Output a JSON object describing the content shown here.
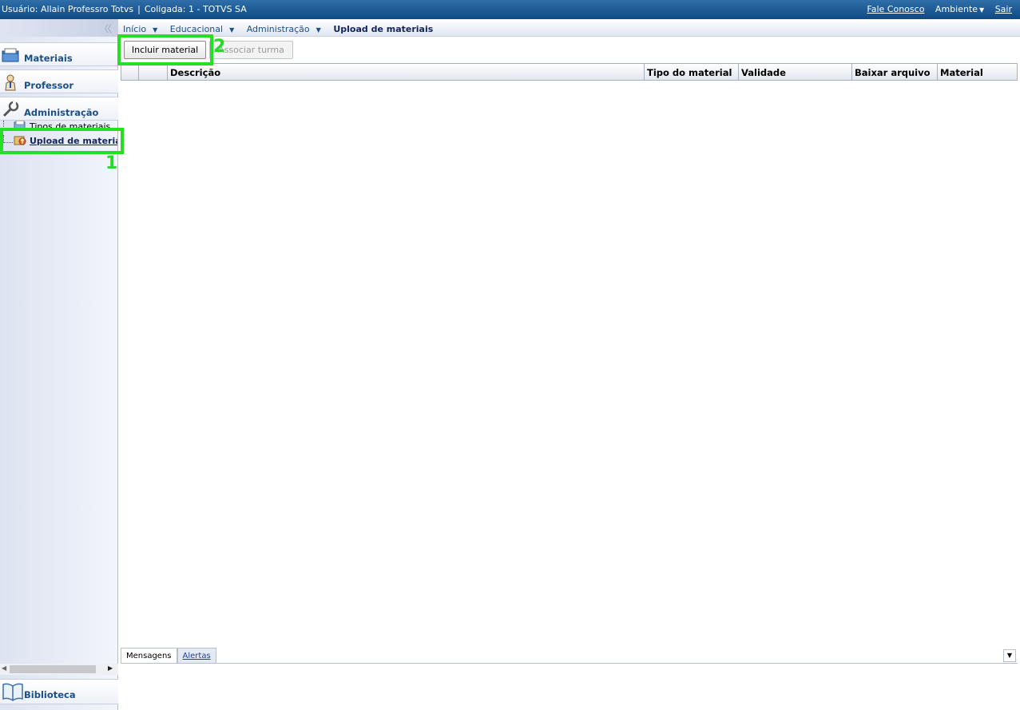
{
  "topbar": {
    "user": "Usuário: Allain Professro Totvs",
    "coligada": "Coligada: 1 - TOTVS SA",
    "fale_conosco": "Fale Conosco",
    "ambiente": "Ambiente",
    "sair": "Sair"
  },
  "sidebar": {
    "sections": [
      {
        "label": "Materiais",
        "icon": "folder-icon"
      },
      {
        "label": "Professor",
        "icon": "person-icon"
      },
      {
        "label": "Administração",
        "icon": "wrench-icon"
      }
    ],
    "tree": [
      {
        "label": "Tipos de materiais"
      },
      {
        "label": "Upload de materiais"
      }
    ],
    "bottom_section": {
      "label": "Biblioteca",
      "icon": "book-icon"
    }
  },
  "breadcrumb": {
    "items": [
      "Início",
      "Educacional",
      "Administração"
    ],
    "current": "Upload de materiais"
  },
  "toolbar": {
    "incluir": "Incluir material",
    "associar": "Associar turma"
  },
  "grid": {
    "columns": [
      "",
      "",
      "Descrição",
      "Tipo do material",
      "Validade",
      "Baixar arquivo",
      "Material"
    ]
  },
  "annotations": {
    "one": "1",
    "two": "2",
    "color": "#22e022"
  },
  "bottom_panel": {
    "tabs": [
      "Mensagens",
      "Alertas"
    ]
  }
}
